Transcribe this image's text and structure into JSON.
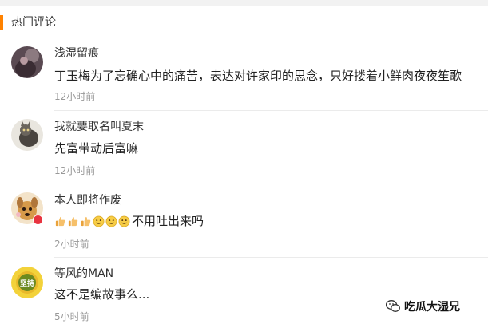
{
  "header": {
    "title": "热门评论"
  },
  "comments": [
    {
      "username": "浅湿留痕",
      "text": "丁玉梅为了忘确心中的痛苦，表达对许家印的思念，只好搂着小鲜肉夜夜笙歌",
      "time": "12小时前",
      "avatar": "avatar-dark-figure"
    },
    {
      "username": "我就要取名叫夏末",
      "text": "先富带动后富嘛",
      "time": "12小时前",
      "avatar": "avatar-cat"
    },
    {
      "username": "本人即将作废",
      "text": "不用吐出来吗",
      "emojis": [
        "thumbs-up-icon",
        "thumbs-up-icon",
        "thumbs-up-icon",
        "smile-icon",
        "smile-icon",
        "smile-icon"
      ],
      "time": "2小时前",
      "avatar": "avatar-dog"
    },
    {
      "username": "等风的MAN",
      "text": "这不是编故事么...",
      "time": "5小时前",
      "avatar": "avatar-jianchi"
    }
  ],
  "avatar_text": "坚持",
  "watermark": {
    "text": "吃瓜大湿兄",
    "icon": "wechat-icon"
  },
  "colors": {
    "accent": "#ff8200",
    "time": "#999999",
    "divider": "#ebebeb"
  }
}
